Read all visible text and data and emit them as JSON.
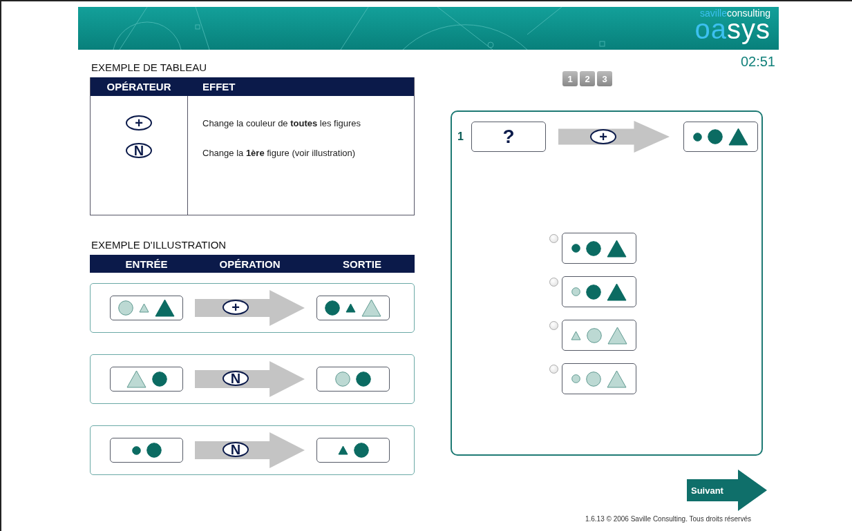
{
  "header": {
    "logo": {
      "company_prefix": "saville",
      "company_suffix": "consulting",
      "product_prefix": "oa",
      "product_suffix": "sys"
    },
    "timer": "02:51"
  },
  "pages": [
    {
      "label": "1"
    },
    {
      "label": "2"
    },
    {
      "label": "3"
    }
  ],
  "operator_table": {
    "title": "EXEMPLE DE TABLEAU",
    "columns": [
      "OPÉRATEUR",
      "EFFET"
    ],
    "rows": [
      {
        "operator": "+",
        "effect": "Change la couleur de **toutes** les figures"
      },
      {
        "operator": "N",
        "effect": "Change la **1ère** figure (voir illustration)"
      }
    ]
  },
  "illustration": {
    "title": "EXEMPLE D'ILLUSTRATION",
    "columns": [
      "ENTRÉE",
      "OPÉRATION",
      "SORTIE"
    ],
    "rows": [
      {
        "input": [
          {
            "kind": "circle",
            "color": "#bcd9d3"
          },
          {
            "kind": "small_triangle",
            "color": "#bcd9d3"
          },
          {
            "kind": "triangle",
            "color": "#0b6b62"
          }
        ],
        "operator": "+",
        "output": [
          {
            "kind": "circle",
            "color": "#0b6b62"
          },
          {
            "kind": "small_triangle",
            "color": "#0b6b62"
          },
          {
            "kind": "triangle",
            "color": "#bcd9d3"
          }
        ]
      },
      {
        "input": [
          {
            "kind": "triangle",
            "color": "#bcd9d3"
          },
          {
            "kind": "circle",
            "color": "#0b6b62"
          }
        ],
        "operator": "N",
        "output": [
          {
            "kind": "circle",
            "color": "#bcd9d3"
          },
          {
            "kind": "circle",
            "color": "#0b6b62"
          }
        ]
      },
      {
        "input": [
          {
            "kind": "dot",
            "color": "#0b6b62"
          },
          {
            "kind": "circle",
            "color": "#0b6b62"
          }
        ],
        "operator": "N",
        "output": [
          {
            "kind": "small_triangle",
            "color": "#0b6b62"
          },
          {
            "kind": "circle",
            "color": "#0b6b62"
          }
        ]
      }
    ]
  },
  "question": {
    "number": "1",
    "input": "?",
    "operator": "+",
    "output": [
      {
        "kind": "dot",
        "color": "#0b6b62"
      },
      {
        "kind": "circle",
        "color": "#0b6b62"
      },
      {
        "kind": "triangle",
        "color": "#0b6b62"
      }
    ],
    "options": [
      {
        "selected": false,
        "figures": [
          {
            "kind": "dot",
            "color": "#0b6b62"
          },
          {
            "kind": "circle",
            "color": "#0b6b62"
          },
          {
            "kind": "triangle",
            "color": "#0b6b62"
          }
        ]
      },
      {
        "selected": false,
        "figures": [
          {
            "kind": "dot",
            "color": "#bcd9d3"
          },
          {
            "kind": "circle",
            "color": "#0b6b62"
          },
          {
            "kind": "triangle",
            "color": "#0b6b62"
          }
        ]
      },
      {
        "selected": false,
        "figures": [
          {
            "kind": "small_triangle",
            "color": "#bcd9d3"
          },
          {
            "kind": "circle",
            "color": "#bcd9d3"
          },
          {
            "kind": "triangle",
            "color": "#bcd9d3"
          }
        ]
      },
      {
        "selected": false,
        "figures": [
          {
            "kind": "dot",
            "color": "#bcd9d3"
          },
          {
            "kind": "circle",
            "color": "#bcd9d3"
          },
          {
            "kind": "triangle",
            "color": "#bcd9d3"
          }
        ]
      }
    ]
  },
  "next_button": "Suivant",
  "footer": "1.6.13 © 2006 Saville Consulting. Tous droits réservés"
}
